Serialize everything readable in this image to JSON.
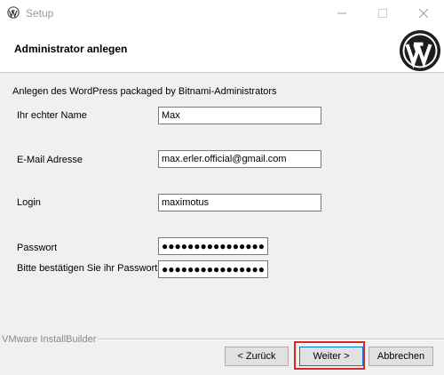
{
  "window": {
    "title": "Setup",
    "controls": {
      "minimize": "minimize",
      "maximize": "maximize",
      "close": "close"
    }
  },
  "header": {
    "title": "Administrator anlegen",
    "logo_icon": "wordpress-logo-icon"
  },
  "form": {
    "description": "Anlegen des WordPress packaged by Bitnami-Administrators",
    "name_label": "Ihr echter Name",
    "name_value": "Max",
    "email_label": "E-Mail Adresse",
    "email_value": "max.erler.official@gmail.com",
    "login_label": "Login",
    "login_value": "maximotus",
    "password_label": "Passwort",
    "password_mask": "●●●●●●●●●●●●●●●●●●●",
    "confirm_label": "Bitte bestätigen Sie ihr Passwort",
    "confirm_mask": "●●●●●●●●●●●●●●●●●●●"
  },
  "footer": {
    "brand": "VMware InstallBuilder",
    "back_label": "< Zurück",
    "next_label": "Weiter >",
    "cancel_label": "Abbrechen",
    "highlight_color": "#d9282a"
  }
}
